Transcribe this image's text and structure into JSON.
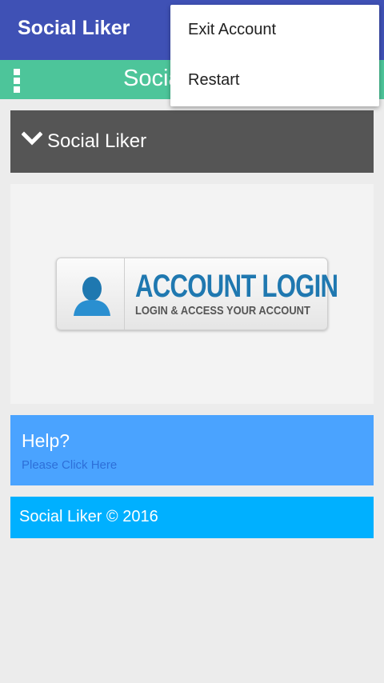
{
  "app_bar": {
    "title": "Social Liker"
  },
  "green_bar": {
    "title": "Social Liker"
  },
  "section_header": {
    "label": "Social Liker",
    "icon": "chevron-down-icon"
  },
  "login_banner": {
    "title": "ACCOUNT LOGIN",
    "subtitle": "LOGIN & ACCESS YOUR ACCOUNT",
    "icon": "user-icon"
  },
  "help": {
    "title": "Help?",
    "link": "Please Click Here"
  },
  "footer": {
    "text": "Social Liker © 2016"
  },
  "menu": {
    "items": [
      {
        "label": "Exit Account"
      },
      {
        "label": "Restart"
      }
    ]
  },
  "colors": {
    "app_bar": "#3f51b5",
    "green_bar": "#4dc59a",
    "section_header": "#555555",
    "help_box": "#4aa3ff",
    "footer_box": "#00b0ff",
    "login_blue": "#1f78b0"
  }
}
